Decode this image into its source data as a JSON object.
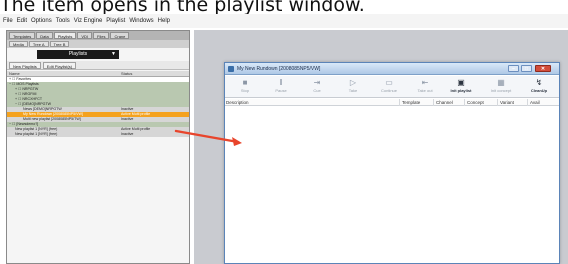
{
  "caption": "The item opens in the playlist window.",
  "menubar": [
    "File",
    "Edit",
    "Options",
    "Tools",
    "Viz Engine",
    "Playlist",
    "Windows",
    "Help"
  ],
  "left_panel": {
    "tabs": [
      "Templates",
      "Data",
      "Playlists",
      "VDI",
      "Files",
      "Crane"
    ],
    "subtabs": [
      "Media",
      "Tree A",
      "Tree B"
    ],
    "playlist_selector": "Playlists",
    "toolbar": [
      "New Playlists",
      "Edit Playlist(s)"
    ],
    "columns": [
      "Name",
      "Status"
    ],
    "rows": [
      {
        "indent": 0,
        "name": "+ ☐ Favorites",
        "status": "",
        "style": "white"
      },
      {
        "indent": 0,
        "name": "− ☐ MOS Playlists",
        "status": "",
        "style": "green"
      },
      {
        "indent": 6,
        "name": "+ ☐ NRPGTW",
        "status": "",
        "style": "green"
      },
      {
        "indent": 6,
        "name": "+ ☐ NRGFMI",
        "status": "",
        "style": "green"
      },
      {
        "indent": 6,
        "name": "+ ☐ NRCXHFCT",
        "status": "",
        "style": "green"
      },
      {
        "indent": 6,
        "name": "− ☐ [DEMO]NRPGTW",
        "status": "",
        "style": "green"
      },
      {
        "indent": 14,
        "name": "News [DEMO]NRPGTW",
        "status": "Inactive",
        "style": "gray"
      },
      {
        "indent": 14,
        "name": "My New Rundown [2008085NP5/VW]",
        "status": "Active Multi profile",
        "style": "sel"
      },
      {
        "indent": 14,
        "name": "Multi new playlist [2008085NP5/TW]",
        "status": "Inactive",
        "style": "gray"
      },
      {
        "indent": 0,
        "name": "− ☐ [Newsdemo?]",
        "status": "",
        "style": "green"
      },
      {
        "indent": 6,
        "name": "New playlist 1 [NYR] (free)",
        "status": "Active Multi profile",
        "style": "gray"
      },
      {
        "indent": 6,
        "name": "New playlist 1 [NYR] (free)",
        "status": "Inactive",
        "style": "gray"
      }
    ]
  },
  "window": {
    "title": "My New Rundown [2008085NP5/VW]",
    "buttons": [
      {
        "icon": "stop-icon",
        "glyph": "■",
        "label": "Stop",
        "enabled": false
      },
      {
        "icon": "pause-icon",
        "glyph": "‖",
        "label": "Pause",
        "enabled": false
      },
      {
        "icon": "cue-icon",
        "glyph": "⇥",
        "label": "Cue",
        "enabled": false
      },
      {
        "icon": "take-icon",
        "glyph": "▷",
        "label": "Take",
        "enabled": false
      },
      {
        "icon": "continue-icon",
        "glyph": "▭",
        "label": "Continue",
        "enabled": false
      },
      {
        "icon": "take-out-icon",
        "glyph": "⇤",
        "label": "Take out",
        "enabled": false
      },
      {
        "icon": "init-playlist-icon",
        "glyph": "▣",
        "label": "Init playlist",
        "enabled": true
      },
      {
        "icon": "init-concept-icon",
        "glyph": "▦",
        "label": "Init concept",
        "enabled": false
      },
      {
        "icon": "cleanup-icon",
        "glyph": "↯",
        "label": "CleanUp",
        "enabled": true
      }
    ],
    "columns": [
      "Description",
      "Template",
      "Channel",
      "Concept",
      "Variant",
      "Avail"
    ]
  },
  "colors": {
    "selection": "#f4a21e",
    "arrow": "#e8452c",
    "tree_green": "#b9c8b0",
    "titlebar": "#aec8e6"
  }
}
